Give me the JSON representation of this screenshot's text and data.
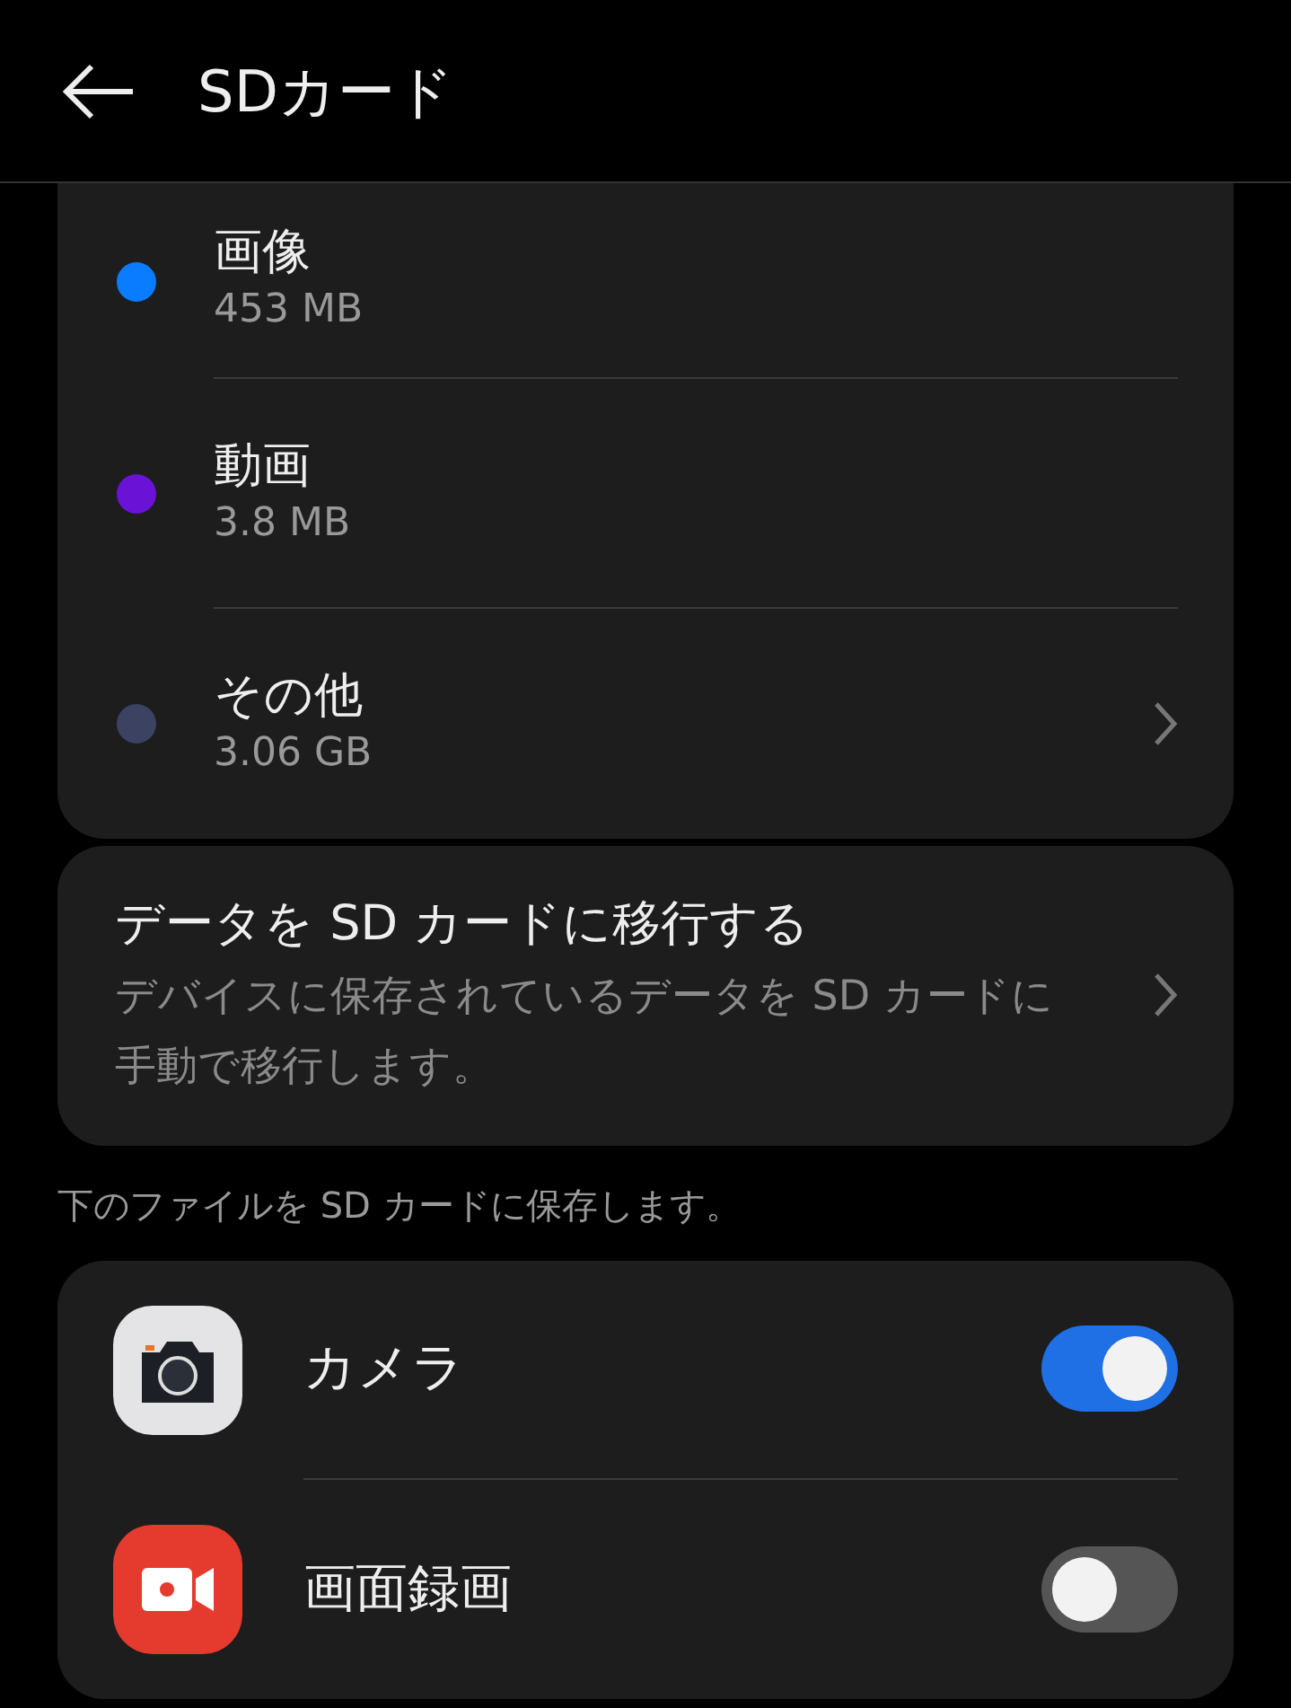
{
  "header": {
    "title": "SDカード"
  },
  "categories": [
    {
      "name": "画像",
      "size": "453 MB",
      "color": "#0a7cff",
      "has_chevron": false
    },
    {
      "name": "動画",
      "size": "3.8 MB",
      "color": "#6a12d6",
      "has_chevron": false
    },
    {
      "name": "その他",
      "size": "3.06 GB",
      "color": "#3b4262",
      "has_chevron": true
    }
  ],
  "migrate": {
    "title": "データを SD カードに移行する",
    "description": "デバイスに保存されているデータを SD カードに手動で移行します。"
  },
  "section_caption": "下のファイルを SD カードに保存します。",
  "apps": [
    {
      "name": "カメラ",
      "kind": "camera",
      "on": true
    },
    {
      "name": "画面録画",
      "kind": "recorder",
      "on": false
    }
  ]
}
